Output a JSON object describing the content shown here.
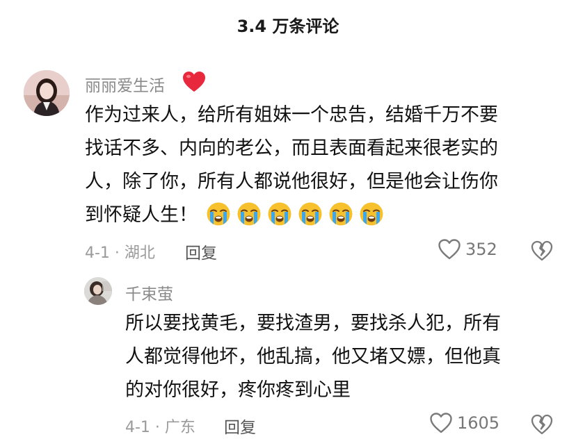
{
  "header": {
    "title": "3.4 万条评论"
  },
  "colors": {
    "text_primary": "#111111",
    "text_secondary": "#8a8a8a",
    "heart_red": "#e8283c",
    "emoji_yellow": "#f6c12d",
    "tear_blue": "#3aa7f0"
  },
  "comments": [
    {
      "username": "丽丽爱生活",
      "badge_icon": "red-heart-emoji",
      "lines": [
        "作为过来人，给所有姐妹一个忠告，结婚千万不要",
        "找话不多、内向的老公，而且表面看起来很老实的",
        "人，除了你，所有人都说他很好，但是他会让伤你",
        "到怀疑人生！"
      ],
      "emoji_icon": "loudly-crying-face-emoji",
      "emoji_count": 6,
      "meta": "4-1 · 湖北",
      "reply_label": "回复",
      "likes": "352",
      "replies": [
        {
          "username": "千束萤",
          "lines": [
            "所以要找黄毛，要找渣男，要找杀人犯，所有",
            "人都觉得他坏，他乱搞，他又堵又嫖，但他真",
            "的对你很好，疼你疼到心里"
          ],
          "meta": "4-1 · 广东",
          "reply_label": "回复",
          "likes": "1605"
        }
      ]
    }
  ]
}
